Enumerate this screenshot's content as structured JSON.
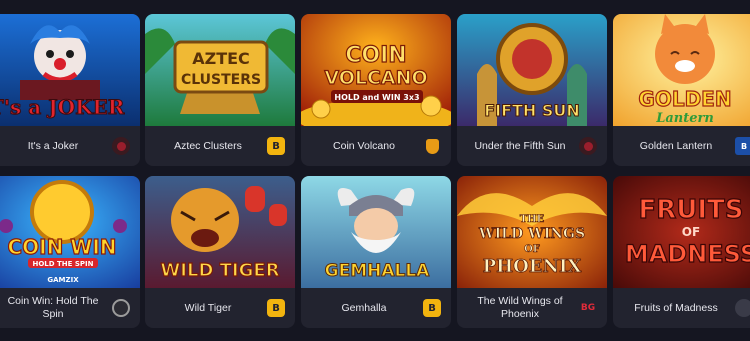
{
  "games": [
    {
      "name": "It's a Joker",
      "art_title": "IT's a JOKER",
      "provider_icon": "provider-red-badge-icon",
      "provider_label": "",
      "accent": "#b01d2e"
    },
    {
      "name": "Aztec Clusters",
      "art_title": "AZTEC CLUSTERS",
      "provider_icon": "provider-b-badge-icon",
      "provider_label": "B",
      "accent": "#f2b40f"
    },
    {
      "name": "Coin Volcano",
      "art_title": "COIN VOLCANO",
      "art_sub": "HOLD and WIN 3x3",
      "provider_icon": "provider-shield-icon",
      "provider_label": "",
      "accent": "#e89b16"
    },
    {
      "name": "Under the Fifth Sun",
      "art_title": "FIFTH SUN",
      "provider_icon": "provider-red-badge-icon",
      "provider_label": "",
      "accent": "#b01d2e"
    },
    {
      "name": "Golden Lantern",
      "art_title": "GOLDEN Lantern",
      "provider_icon": "provider-blue-badge-icon",
      "provider_label": "B",
      "accent": "#1c4fa8"
    },
    {
      "name": "Coin Win: Hold The Spin",
      "art_title": "COIN WIN",
      "art_sub": "HOLD THE SPIN",
      "art_brand": "GAMZIX",
      "provider_icon": "provider-circle-icon",
      "provider_label": "",
      "accent": "#9b9b9b"
    },
    {
      "name": "Wild Tiger",
      "art_title": "WILD TIGER",
      "provider_icon": "provider-b-badge-icon",
      "provider_label": "B",
      "accent": "#f2b40f"
    },
    {
      "name": "Gemhalla",
      "art_title": "GEMHALLA",
      "provider_icon": "provider-b-badge-icon",
      "provider_label": "B",
      "accent": "#f2b40f"
    },
    {
      "name": "The Wild Wings of Phoenix",
      "art_title": "THE WILD WINGS OF PHOENIX",
      "provider_icon": "provider-bg-badge-icon",
      "provider_label": "BG",
      "accent": "#e02b3a"
    },
    {
      "name": "Fruits of Madness",
      "art_title": "FRUITS OF MADNESS",
      "provider_icon": "provider-grey-badge-icon",
      "provider_label": "",
      "accent": "#3a3b48"
    }
  ]
}
